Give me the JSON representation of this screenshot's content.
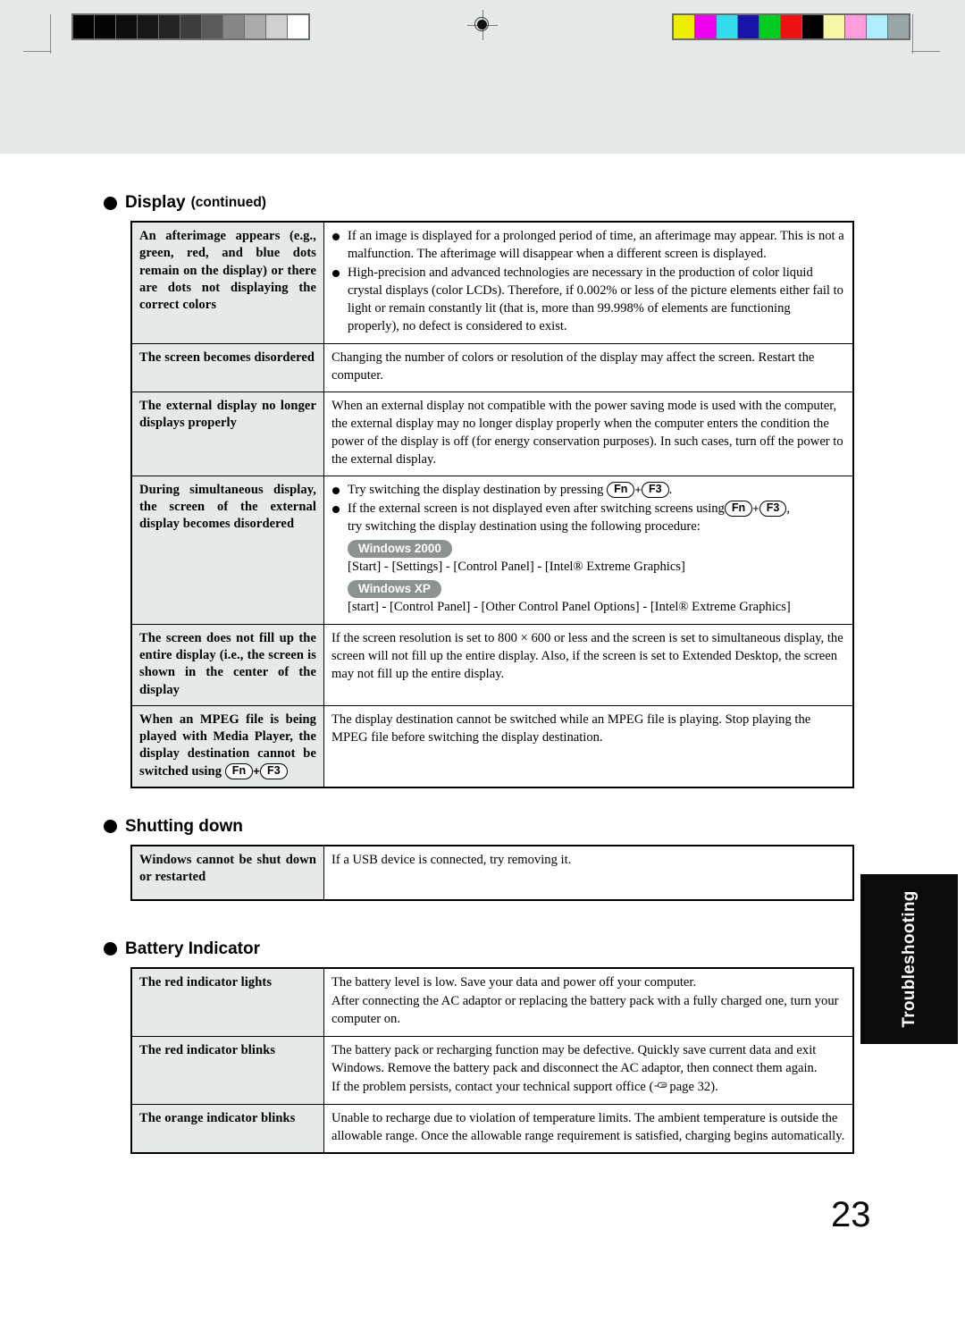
{
  "document": {
    "page_number": "23",
    "side_tab_label": "Troubleshooting"
  },
  "calibration": {
    "gray_strip_label": "grayscale-calibration-strip",
    "gray_patches": [
      "#000000",
      "#050505",
      "#0d0d0d",
      "#171717",
      "#242424",
      "#3d3d3d",
      "#5a5a5a",
      "#868686",
      "#ababab",
      "#d0d0d0",
      "#ffffff"
    ],
    "color_strip_label": "color-calibration-strip",
    "color_patches": [
      "#eeee00",
      "#ee00ee",
      "#33ddee",
      "#1a13a8",
      "#00cc22",
      "#ee1111",
      "#000000",
      "#f7f7a8",
      "#ff9ddd",
      "#b0eeff",
      "#9aa5a5"
    ]
  },
  "sections": [
    {
      "title": "Display",
      "subtitle": "(continued)",
      "rows": [
        {
          "label": "An afterimage appears (e.g., green, red, and blue dots remain on the display) or there are dots not displaying the correct colors",
          "bullets": [
            "If an image is displayed for a prolonged period of time, an afterimage may appear.  This is not a malfunction.  The afterimage will disappear when a different screen is displayed.",
            "High-precision and advanced technologies are necessary in the production of color liquid crystal displays (color LCDs).  Therefore, if 0.002% or less of the picture elements either fail to light or remain constantly lit (that is, more than 99.998% of elements are functioning properly), no defect is considered to exist."
          ]
        },
        {
          "label": "The screen becomes disordered",
          "text": "Changing the number of colors or resolution of the display may affect the screen. Restart the computer."
        },
        {
          "label": "The external display no longer displays properly",
          "text": "When an external display not compatible with the power saving mode is used with the computer, the external display may no longer display properly when the computer enters the condition the power of the display is off (for energy conservation purposes).  In such cases, turn off the power to the external display."
        },
        {
          "label_prefix": "During simultaneous display, the screen of the external display becomes disordered",
          "bullet1_pre": "Try switching the display destination by pressing",
          "bullet1_key1": "Fn",
          "bullet1_plus": "+",
          "bullet1_key2": "F3",
          "bullet1_post": ".",
          "bullet2_pre": "If the external screen is not displayed even after switching screens using",
          "bullet2_key1": "Fn",
          "bullet2_plus": "+",
          "bullet2_key2": "F3",
          "bullet2_post": ",",
          "bullet2_line2": "try switching the display destination using the following procedure:",
          "badge_win2000": "Windows 2000",
          "path_win2000": "[Start] - [Settings] - [Control Panel] - [Intel®  Extreme Graphics]",
          "badge_winxp": "Windows XP",
          "path_winxp": "[start] - [Control Panel] - [Other Control Panel Options] - [Intel®  Extreme Graphics]"
        },
        {
          "label": "The screen does not fill up the entire display (i.e., the screen is shown in the center of the display",
          "text": "If the screen resolution is set to 800 × 600 or less and the screen is set to simultaneous display, the screen will not fill up the entire display. Also, if the screen is set to Extended Desktop, the screen may not fill up the entire display."
        },
        {
          "label_prefix": "When an MPEG file is being played with Media Player, the display destination cannot be switched using",
          "label_key1": "Fn",
          "label_plus": "+",
          "label_key2": "F3",
          "text": "The display destination cannot be switched while an MPEG file is playing.  Stop playing the MPEG file before switching the display destination."
        }
      ]
    },
    {
      "title": "Shutting down",
      "subtitle": "",
      "rows": [
        {
          "label": "Windows cannot be shut down or restarted",
          "text": "If a USB device is connected, try removing it."
        }
      ]
    },
    {
      "title": "Battery Indicator",
      "subtitle": "",
      "rows": [
        {
          "label": "The red indicator lights",
          "lines": [
            "The battery level is low.  Save your data and power off your computer.",
            "After connecting the AC adaptor or replacing the battery pack with a fully charged one, turn your computer on."
          ]
        },
        {
          "label": "The red indicator blinks",
          "lines": [
            "The battery pack or recharging function may be defective.  Quickly save current data and exit Windows.  Remove the battery pack and disconnect the AC adaptor, then connect them again."
          ],
          "ref_pre": "If the problem persists, contact your technical support office (",
          "ref_page": "page 32",
          "ref_post": ")."
        },
        {
          "label": "The orange indicator blinks",
          "lines": [
            "Unable to recharge due to violation of temperature limits. The ambient temperature is outside the allowable range. Once the allowable range requirement is satisfied, charging begins automatically."
          ]
        }
      ]
    }
  ]
}
